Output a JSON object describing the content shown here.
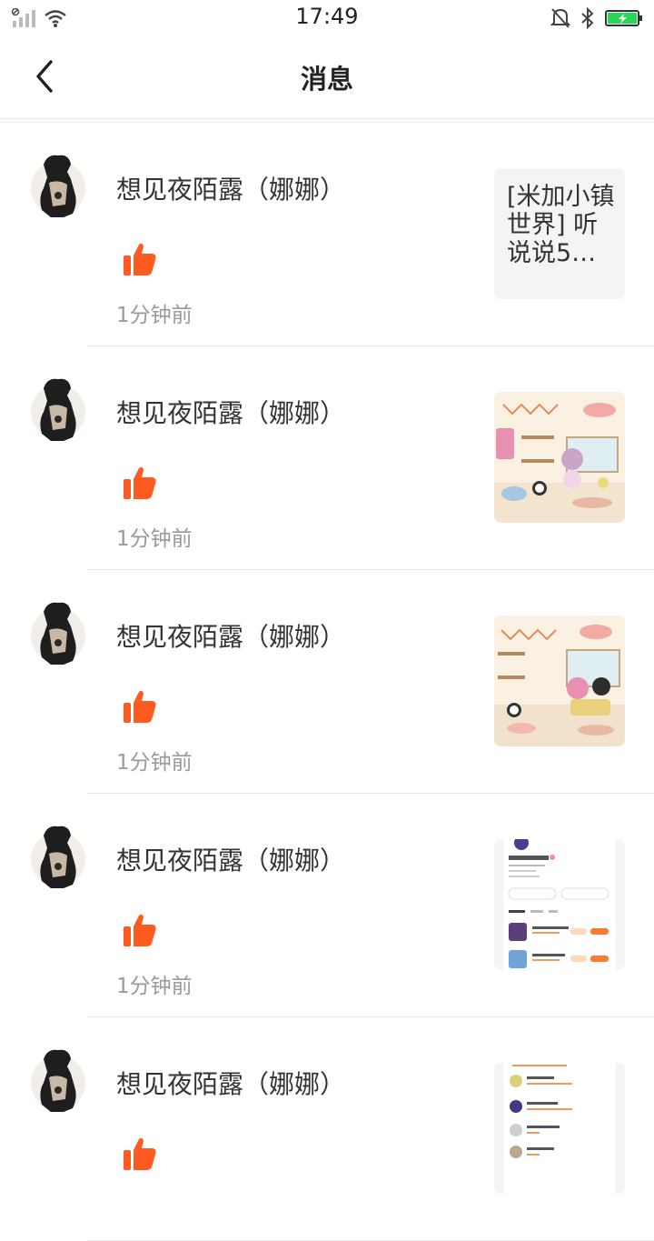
{
  "status_bar": {
    "time": "17:49"
  },
  "header": {
    "title": "消息",
    "back_icon": "chevron-left-icon"
  },
  "messages": [
    {
      "name": "想见夜陌露（娜娜）",
      "action_icon": "thumbs-up-icon",
      "time": "1分钟前",
      "preview_type": "text",
      "preview_text": "[米加小镇世界] 听说说5…"
    },
    {
      "name": "想见夜陌露（娜娜）",
      "action_icon": "thumbs-up-icon",
      "time": "1分钟前",
      "preview_type": "image",
      "preview_image": "room-scene-image"
    },
    {
      "name": "想见夜陌露（娜娜）",
      "action_icon": "thumbs-up-icon",
      "time": "1分钟前",
      "preview_type": "image",
      "preview_image": "room-scene-image"
    },
    {
      "name": "想见夜陌露（娜娜）",
      "action_icon": "thumbs-up-icon",
      "time": "1分钟前",
      "preview_type": "image",
      "preview_image": "profile-screenshot-image"
    },
    {
      "name": "想见夜陌露（娜娜）",
      "action_icon": "thumbs-up-icon",
      "time": "",
      "preview_type": "image",
      "preview_image": "list-screenshot-image"
    }
  ],
  "colors": {
    "accent": "#ff5a1f",
    "battery": "#2bd45b"
  }
}
